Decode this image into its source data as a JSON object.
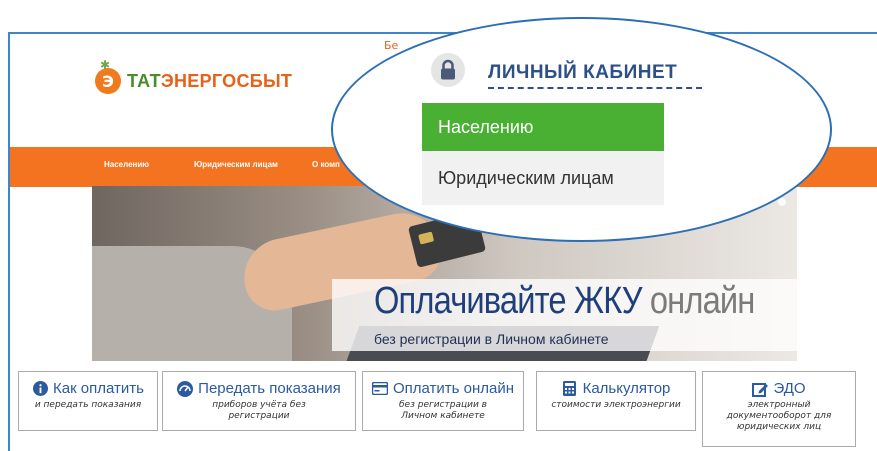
{
  "header": {
    "top_link": "Бе",
    "logo": {
      "part1": "ТАТ",
      "part2": "ЭНЕРГОСБЫТ",
      "mark": "Э"
    }
  },
  "nav": {
    "items": [
      "Населению",
      "Юридическим лицам",
      "О комп"
    ]
  },
  "banner": {
    "slogan_main": "Оплачивайте ЖКУ",
    "slogan_accent": "онлайн",
    "subtitle": "без регистрации в Личном кабинете"
  },
  "tiles": [
    {
      "icon": "info-icon",
      "title": "Как оплатить",
      "subtitle": "и передать показания"
    },
    {
      "icon": "dashboard-icon",
      "title": "Передать показания",
      "subtitle": "приборов учёта без регистрации"
    },
    {
      "icon": "credit-card-icon",
      "title": "Оплатить онлайн",
      "subtitle": "без регистрации в Личном кабинете"
    },
    {
      "icon": "calculator-icon",
      "title": "Калькулятор",
      "subtitle": "стоимости электроэнергии"
    },
    {
      "icon": "edit-icon",
      "title": "ЭДО",
      "subtitle": "электронный документооборот для юридических лиц"
    }
  ],
  "cabinet": {
    "title": "ЛИЧНЫЙ КАБИНЕТ",
    "menu": [
      {
        "label": "Населению",
        "active": true
      },
      {
        "label": "Юридическим лицам",
        "active": false
      }
    ]
  },
  "colors": {
    "accent_orange": "#f37321",
    "active_green": "#4ab034",
    "link_blue": "#2b5aa0",
    "lens_border": "#2d6fb6"
  }
}
